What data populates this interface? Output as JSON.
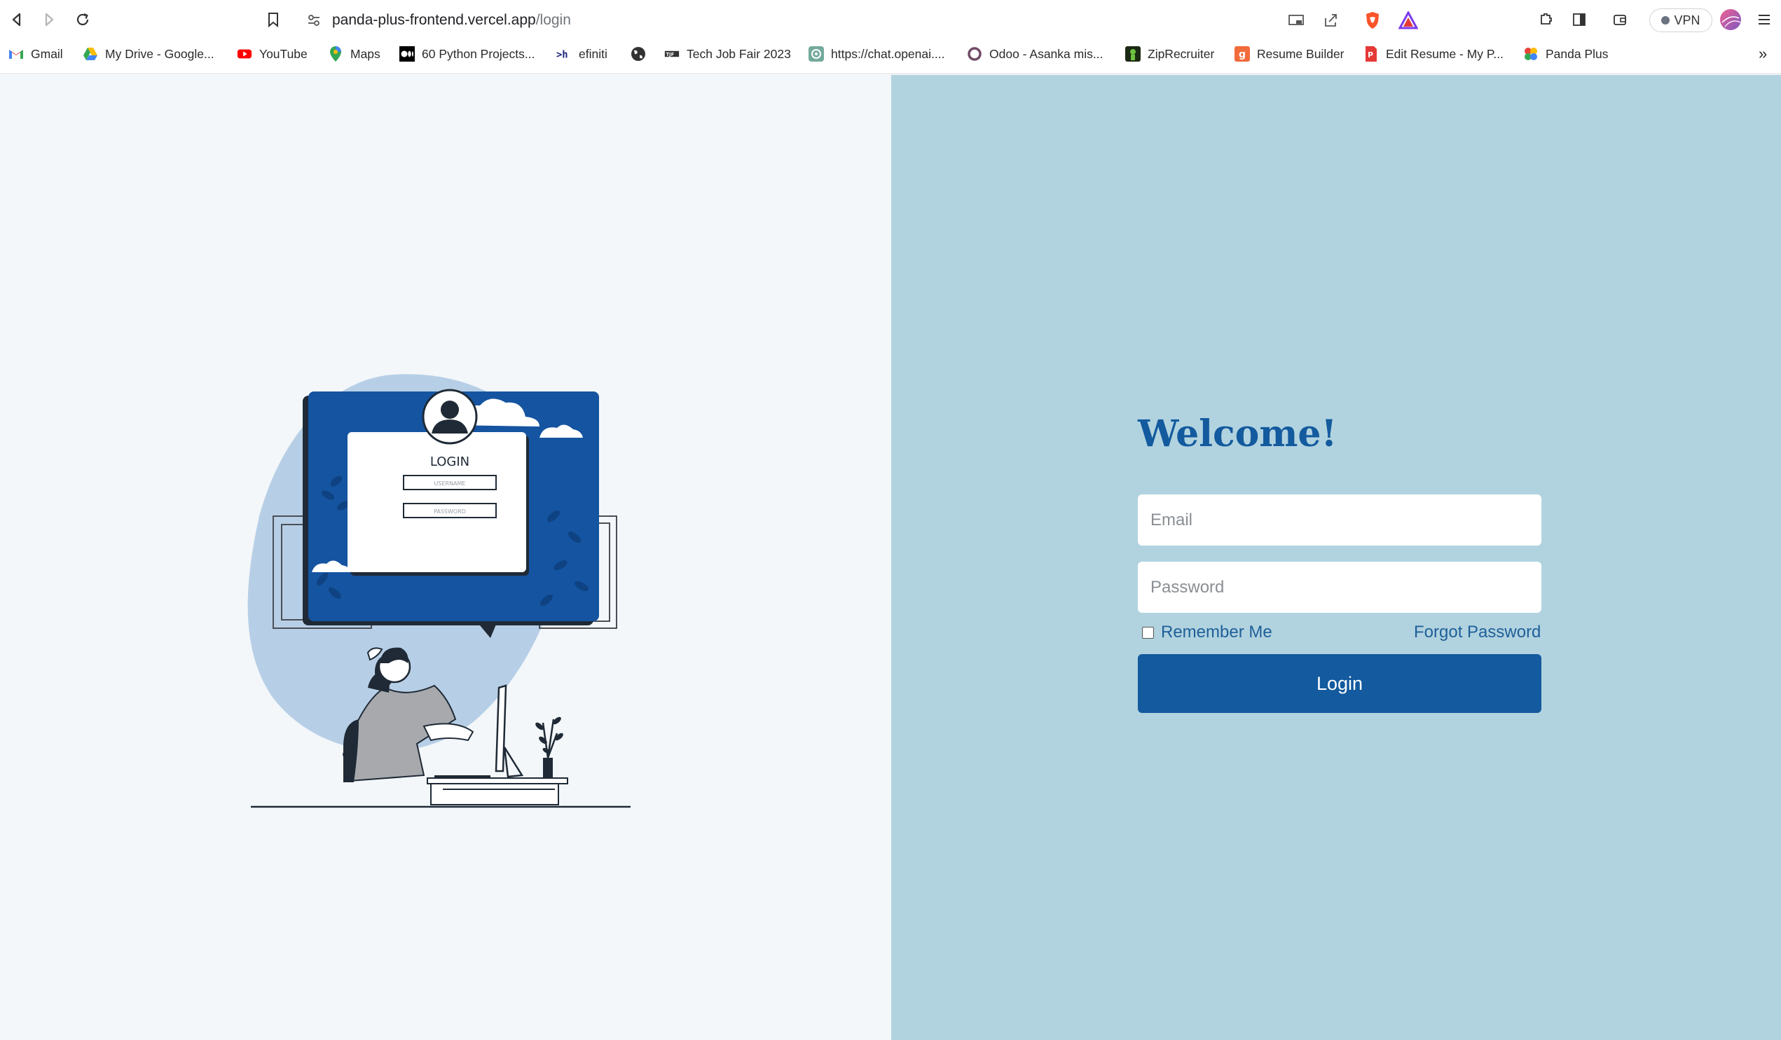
{
  "browser": {
    "url_host": "panda-plus-frontend.vercel.app",
    "url_path": "/login",
    "vpn_label": "VPN",
    "bookmarks": [
      {
        "label": "Gmail",
        "icon": "gmail-icon"
      },
      {
        "label": "My Drive - Google...",
        "icon": "drive-icon"
      },
      {
        "label": "YouTube",
        "icon": "youtube-icon"
      },
      {
        "label": "Maps",
        "icon": "maps-icon"
      },
      {
        "label": "60 Python Projects...",
        "icon": "medium-icon"
      },
      {
        "label": "efiniti",
        "icon": "efiniti-icon"
      },
      {
        "label": "",
        "icon": "globe-icon"
      },
      {
        "label": "Tech Job Fair 2023",
        "icon": "jobfair-icon"
      },
      {
        "label": "https://chat.openai....",
        "icon": "openai-icon"
      },
      {
        "label": "Odoo - Asanka mis...",
        "icon": "odoo-icon"
      },
      {
        "label": "ZipRecruiter",
        "icon": "ziprecruiter-icon"
      },
      {
        "label": "Resume Builder",
        "icon": "resume-builder-icon"
      },
      {
        "label": "Edit Resume - My P...",
        "icon": "edit-resume-icon"
      },
      {
        "label": "Panda Plus",
        "icon": "panda-plus-icon"
      }
    ],
    "more_label": "»"
  },
  "illustration": {
    "login_title": "LOGIN",
    "username_label": "USERNAME",
    "password_label": "PASSWORD"
  },
  "form": {
    "title": "Welcome!",
    "email_placeholder": "Email",
    "password_placeholder": "Password",
    "remember_label": "Remember Me",
    "forgot_label": "Forgot Password",
    "submit_label": "Login"
  },
  "colors": {
    "accent": "#135a9e",
    "panel": "#b1d3df",
    "left_bg": "#f3f7fa"
  }
}
